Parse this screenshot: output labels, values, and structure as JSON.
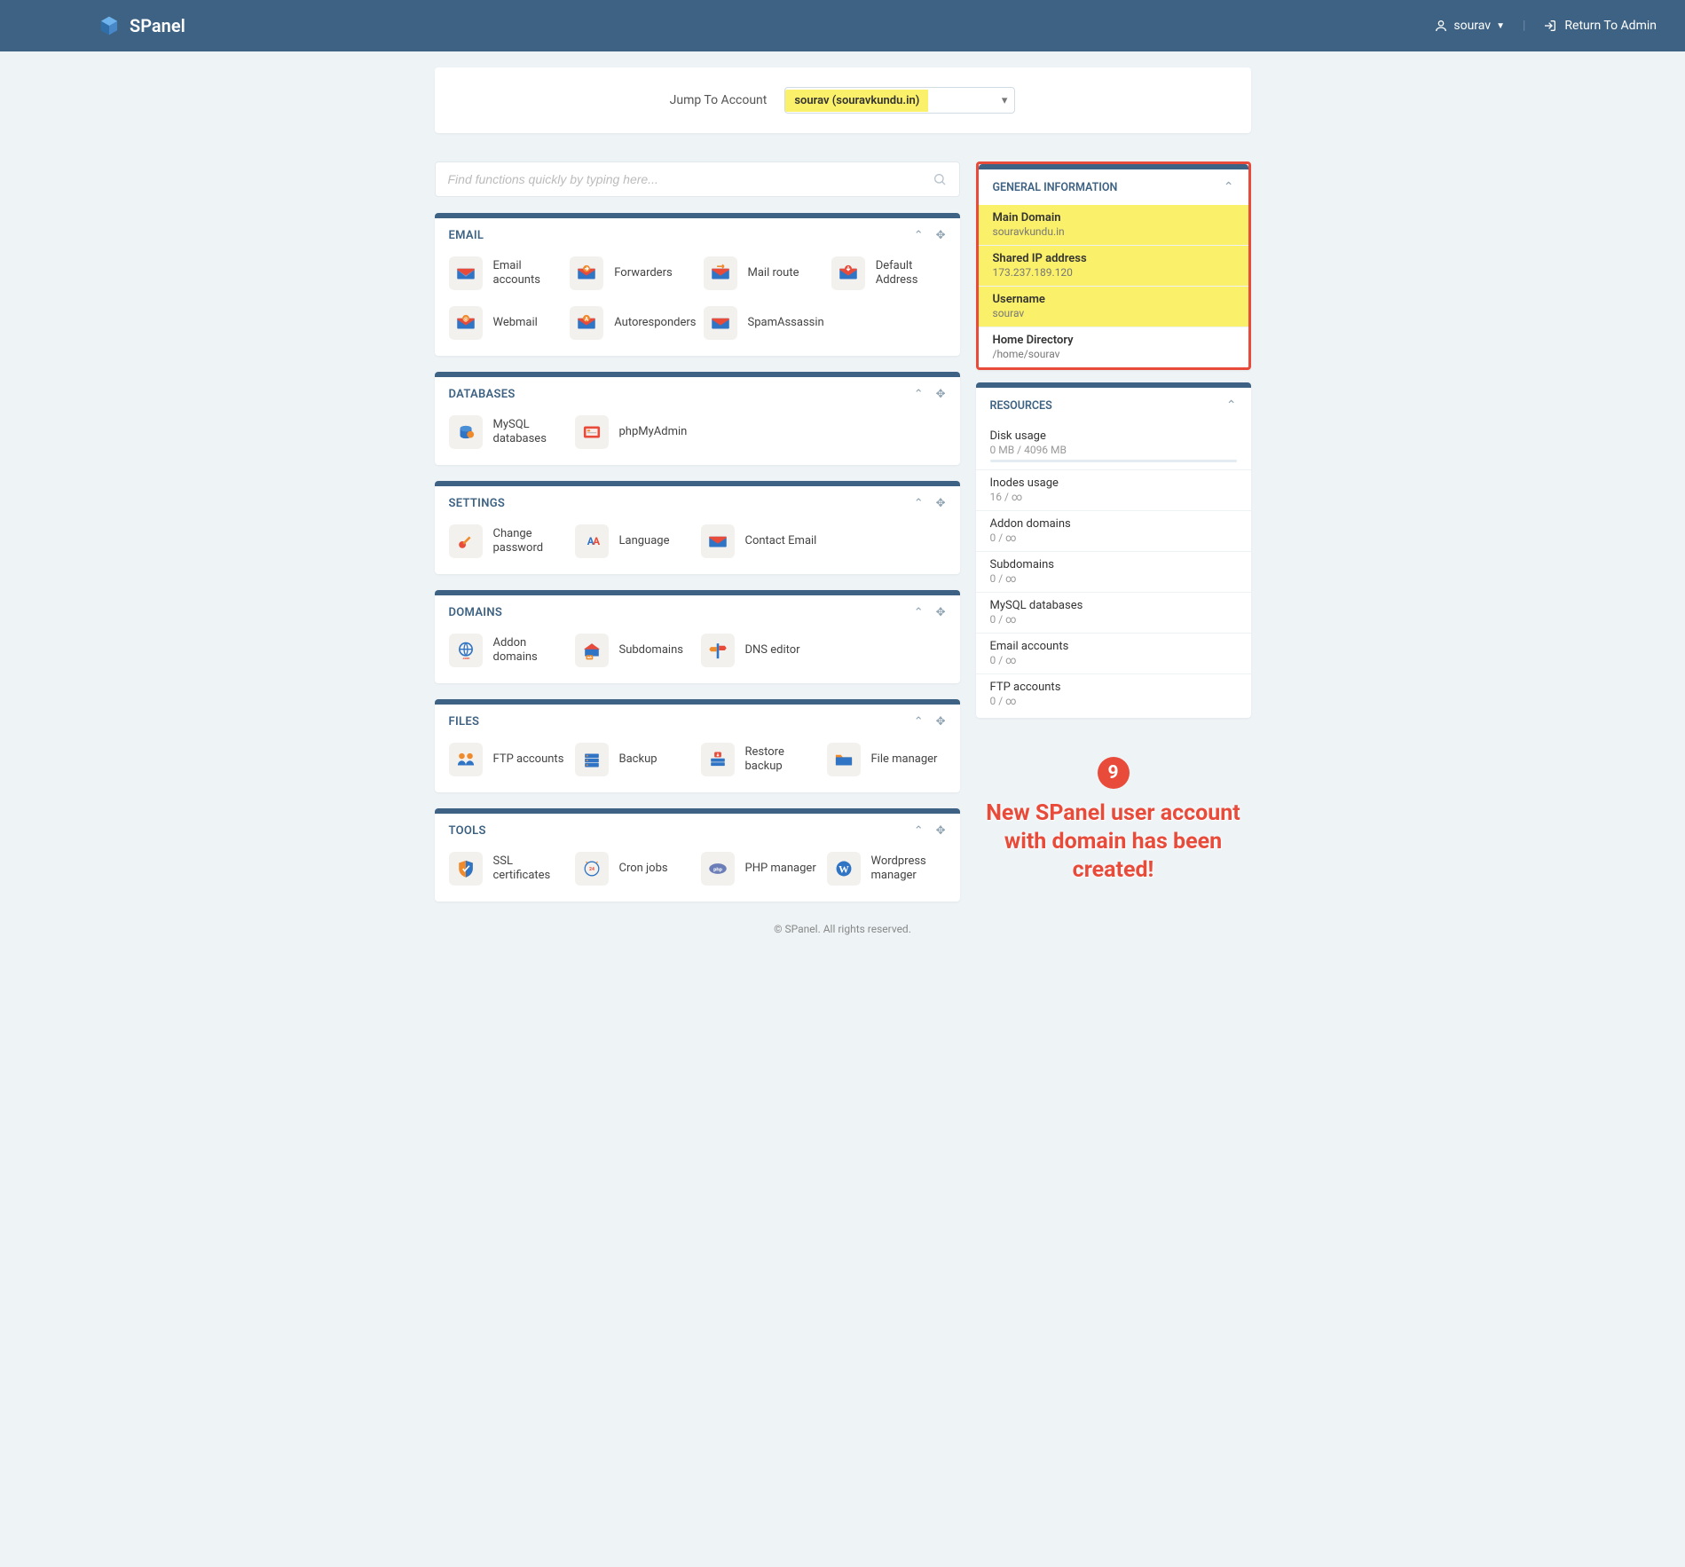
{
  "header": {
    "brand": "SPanel",
    "user": "sourav",
    "return": "Return To Admin"
  },
  "jump": {
    "label": "Jump To Account",
    "selected": "sourav (souravkundu.in)"
  },
  "search": {
    "placeholder": "Find functions quickly by typing here..."
  },
  "panels": {
    "email": {
      "title": "EMAIL",
      "items": [
        "Email accounts",
        "Forwarders",
        "Mail route",
        "Default Address",
        "Webmail",
        "Autoresponders",
        "SpamAssassin"
      ]
    },
    "databases": {
      "title": "DATABASES",
      "items": [
        "MySQL databases",
        "phpMyAdmin"
      ]
    },
    "settings": {
      "title": "SETTINGS",
      "items": [
        "Change password",
        "Language",
        "Contact Email"
      ]
    },
    "domains": {
      "title": "DOMAINS",
      "items": [
        "Addon domains",
        "Subdomains",
        "DNS editor"
      ]
    },
    "files": {
      "title": "FILES",
      "items": [
        "FTP accounts",
        "Backup",
        "Restore backup",
        "File manager"
      ]
    },
    "tools": {
      "title": "TOOLS",
      "items": [
        "SSL certificates",
        "Cron jobs",
        "PHP manager",
        "Wordpress manager"
      ]
    }
  },
  "general": {
    "title": "GENERAL INFORMATION",
    "rows": [
      {
        "k": "Main Domain",
        "v": "souravkundu.in",
        "hl": true
      },
      {
        "k": "Shared IP address",
        "v": "173.237.189.120",
        "hl": true
      },
      {
        "k": "Username",
        "v": "sourav",
        "hl": true
      },
      {
        "k": "Home Directory",
        "v": "/home/sourav",
        "hl": false
      }
    ]
  },
  "resources": {
    "title": "RESOURCES",
    "rows": [
      {
        "k": "Disk usage",
        "v": "0 MB / 4096 MB",
        "bar": true
      },
      {
        "k": "Inodes usage",
        "v": "16 / ∞"
      },
      {
        "k": "Addon domains",
        "v": "0 / ∞"
      },
      {
        "k": "Subdomains",
        "v": "0 / ∞"
      },
      {
        "k": "MySQL databases",
        "v": "0 / ∞"
      },
      {
        "k": "Email accounts",
        "v": "0 / ∞"
      },
      {
        "k": "FTP accounts",
        "v": "0 / ∞"
      }
    ]
  },
  "annotation": {
    "num": "9",
    "text": "New SPanel user account with domain has been created!"
  },
  "footer": "© SPanel. All rights reserved."
}
